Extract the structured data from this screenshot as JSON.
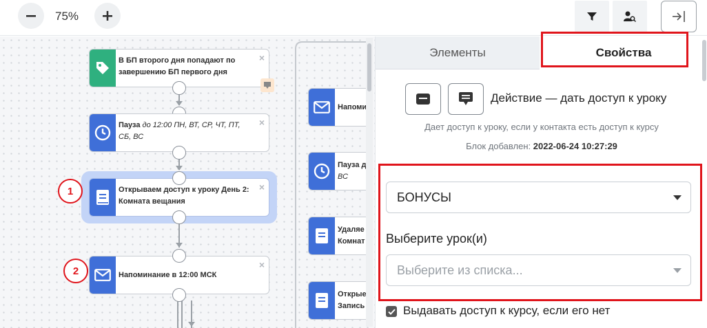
{
  "toolbar": {
    "zoom": "75%",
    "icons": [
      "minus-icon",
      "plus-icon",
      "filter-icon",
      "user-search-icon",
      "exit-panel-icon"
    ]
  },
  "canvas": {
    "nodes": [
      {
        "text": "В БП второго дня попадают по завершению БП первого дня",
        "icon": "tag-icon",
        "color": "#2fb07f"
      },
      {
        "text_bold": "Пауза",
        "text_italic": " до 12:00 ПН, ВТ, СР, ЧТ, ПТ, СБ, ВС",
        "icon": "clock-icon",
        "color": "#3f6fd8"
      },
      {
        "text": "Открываем доступ к уроку День 2: Комната вещания",
        "icon": "book-icon",
        "color": "#3f6fd8",
        "marker": "1"
      },
      {
        "text": "Напоминание в 12:00 МСК",
        "icon": "mail-icon",
        "color": "#3f6fd8",
        "marker": "2"
      }
    ],
    "right_nodes": [
      {
        "line1": "Напоми",
        "line2": "",
        "icon": "mail-icon"
      },
      {
        "line1": "Пауза д",
        "line2": "ВС",
        "icon": "clock-icon"
      },
      {
        "line1": "Удаляе",
        "line2": "Комнат",
        "icon": "book-icon"
      },
      {
        "line1": "Открые",
        "line2": "Запись",
        "icon": "book-icon"
      }
    ]
  },
  "panel": {
    "tabs": {
      "elements": "Элементы",
      "properties": "Свойства"
    },
    "action_title": "Действие — дать доступ к уроку",
    "action_desc": "Дает доступ к уроку, если у контакта есть доступ к курсу",
    "added_label": "Блок добавлен:",
    "added_value": "2022-06-24 10:27:29",
    "course_select": "БОНУСЫ",
    "lesson_label": "Выберите урок(и)",
    "lesson_placeholder": "Выберите из списка...",
    "grant_access_label": "Выдавать доступ к курсу, если его нет",
    "grant_access_checked": true
  },
  "colors": {
    "accent": "#3f6fd8",
    "green": "#2fb07f",
    "highlight": "#e0141b"
  }
}
